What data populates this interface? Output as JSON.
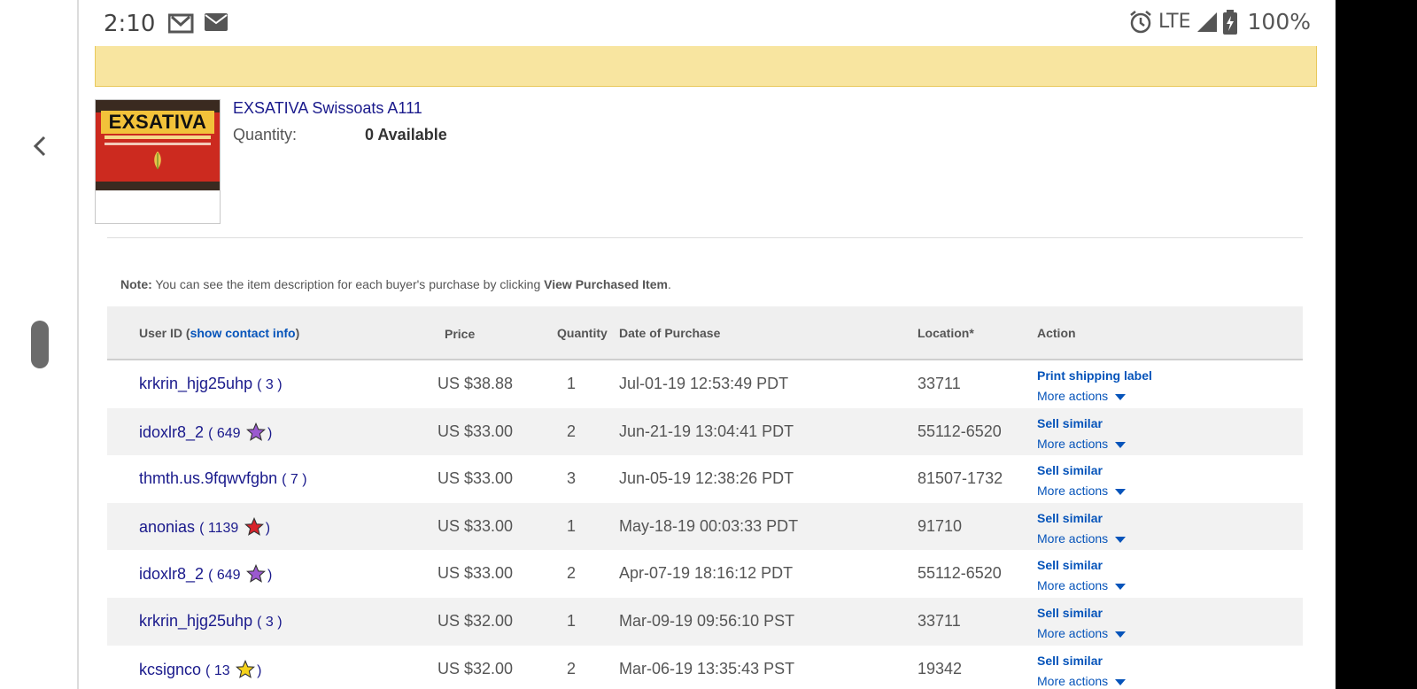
{
  "status_bar": {
    "time": "2:10",
    "network": "LTE",
    "battery": "100%",
    "icons": [
      "gmail-icon",
      "email-icon",
      "alarm-icon",
      "signal-icon",
      "battery-charging-icon"
    ]
  },
  "product": {
    "title": "EXSATIVA Swissoats A111",
    "quantity_label": "Quantity:",
    "quantity_value": "0 Available",
    "thumb_brand": "EXSATIVA"
  },
  "note": {
    "label": "Note:",
    "text": " You can see the item description for each buyer's purchase by clicking ",
    "link_text": "View Purchased Item",
    "end": "."
  },
  "table": {
    "headers": {
      "user_id": "User ID (",
      "contact_link": "show contact info",
      "user_id_end": ")",
      "price": "Price",
      "quantity": "Quantity",
      "date": "Date of Purchase",
      "location": "Location*",
      "action": "Action"
    },
    "more_actions_label": "More actions",
    "rows": [
      {
        "user": "krkrin_hjg25uhp",
        "feedback": "3",
        "star": "",
        "price": "US $38.88",
        "qty": "1",
        "date": "Jul-01-19 12:53:49 PDT",
        "location": "33711",
        "action": "Print shipping label"
      },
      {
        "user": "idoxlr8_2",
        "feedback": "649",
        "star": "purple",
        "price": "US $33.00",
        "qty": "2",
        "date": "Jun-21-19 13:04:41 PDT",
        "location": "55112-6520",
        "action": "Sell similar"
      },
      {
        "user": "thmth.us.9fqwvfgbn",
        "feedback": "7",
        "star": "",
        "price": "US $33.00",
        "qty": "3",
        "date": "Jun-05-19 12:38:26 PDT",
        "location": "81507-1732",
        "action": "Sell similar"
      },
      {
        "user": "anonias",
        "feedback": "1139",
        "star": "red",
        "price": "US $33.00",
        "qty": "1",
        "date": "May-18-19 00:03:33 PDT",
        "location": "91710",
        "action": "Sell similar"
      },
      {
        "user": "idoxlr8_2",
        "feedback": "649",
        "star": "purple",
        "price": "US $33.00",
        "qty": "2",
        "date": "Apr-07-19 18:16:12 PDT",
        "location": "55112-6520",
        "action": "Sell similar"
      },
      {
        "user": "krkrin_hjg25uhp",
        "feedback": "3",
        "star": "",
        "price": "US $32.00",
        "qty": "1",
        "date": "Mar-09-19 09:56:10 PST",
        "location": "33711",
        "action": "Sell similar"
      },
      {
        "user": "kcsignco",
        "feedback": "13",
        "star": "yellow",
        "price": "US $32.00",
        "qty": "2",
        "date": "Mar-06-19 13:35:43 PST",
        "location": "19342",
        "action": "Sell similar"
      }
    ]
  },
  "colors": {
    "link": "#1a1a8c",
    "action_link": "#0654ba",
    "banner": "#f8e5a0",
    "star_purple": "#9b59d0",
    "star_red": "#d8232a",
    "star_yellow": "#f5d21a"
  }
}
